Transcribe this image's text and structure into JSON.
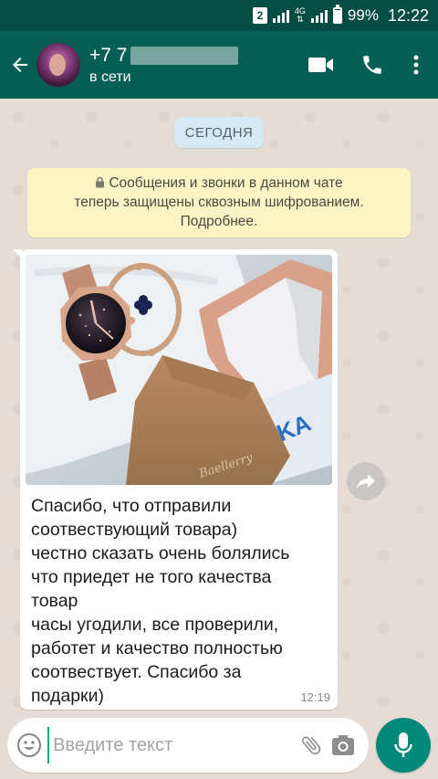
{
  "status_bar": {
    "sim_badge": "2",
    "network": "4G",
    "battery": "99%",
    "time": "12:22"
  },
  "header": {
    "contact_name_visible": "+7 7",
    "status": "в сети",
    "icons": [
      "back-arrow-icon",
      "video-call-icon",
      "phone-icon",
      "more-vert-icon"
    ]
  },
  "chat": {
    "date_chip": "СЕГОДНЯ",
    "encryption_notice": {
      "line1": "Сообщения и звонки в данном чате",
      "line2": "теперь защищены сквозным шифрованием.",
      "line3": "Подробнее."
    },
    "message": {
      "lines": [
        "Спасибо, что отправили",
        "соотвествующий товара)",
        "честно сказать очень болялись",
        "что приедет не того качества",
        "товар",
        "часы угодили, все проверили,",
        "работет и качество полностью",
        "соотвествует. Спасибо за",
        "подарки)"
      ],
      "time": "12:19"
    }
  },
  "input": {
    "placeholder": "Введите текст",
    "value": ""
  },
  "colors": {
    "header": "#075e54",
    "status_bar": "#054d44",
    "mic_button": "#00897b",
    "chat_bg": "#e5ddd5",
    "notice_bg": "#fdf4c5",
    "date_chip_bg": "#d5eaf4"
  }
}
